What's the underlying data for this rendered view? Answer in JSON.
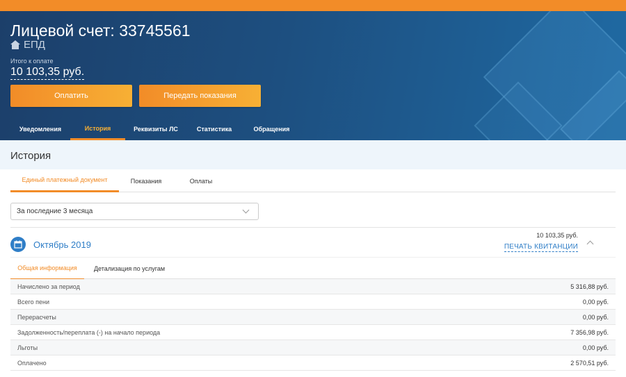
{
  "header": {
    "account_title": "Лицевой счет: 33745561",
    "account_type": "ЕПД",
    "total_label": "Итого к оплате",
    "total_value": "10 103,35 руб.",
    "pay_button": "Оплатить",
    "readings_button": "Передать показания",
    "nav": [
      {
        "label": "Уведомления"
      },
      {
        "label": "История"
      },
      {
        "label": "Реквизиты ЛС"
      },
      {
        "label": "Статистика"
      },
      {
        "label": "Обращения"
      }
    ],
    "active_nav": "История"
  },
  "section": {
    "title": "История",
    "tabs": [
      {
        "label": "Единый платежный документ"
      },
      {
        "label": "Показания"
      },
      {
        "label": "Оплаты"
      }
    ],
    "period_select": "За последние 3 месяца"
  },
  "month": {
    "name": "Октябрь 2019",
    "amount": "10 103,35 руб.",
    "print_label": "ПЕЧАТЬ КВИТАНЦИИ",
    "subtabs": [
      {
        "label": "Общая информация"
      },
      {
        "label": "Детализация по услугам"
      }
    ],
    "rows": [
      {
        "label": "Начислено за период",
        "value": "5 316,88 руб."
      },
      {
        "label": "Всего пени",
        "value": "0,00 руб."
      },
      {
        "label": "Перерасчеты",
        "value": "0,00 руб."
      },
      {
        "label": "Задолженность/переплата (-) на начало периода",
        "value": "7 356,98 руб."
      },
      {
        "label": "Льготы",
        "value": "0,00 руб."
      },
      {
        "label": "Оплачено",
        "value": "2 570,51 руб."
      }
    ]
  },
  "colors": {
    "accent_orange": "#f28c28",
    "header_blue": "#1d4f80",
    "link_blue": "#2f7ec7"
  }
}
